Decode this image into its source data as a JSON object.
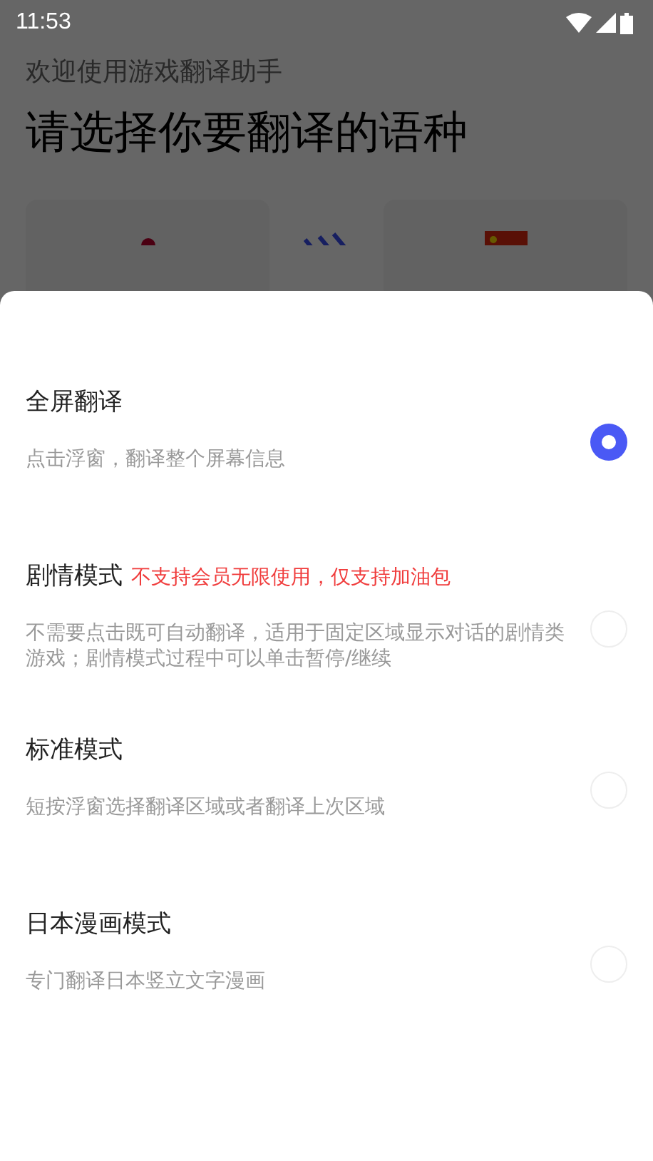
{
  "status_bar": {
    "time": "11:53"
  },
  "header": {
    "subtitle": "欢迎使用游戏翻译助手",
    "title": "请选择你要翻译的语种"
  },
  "modes": [
    {
      "title": "全屏翻译",
      "description": "点击浮窗，翻译整个屏幕信息",
      "selected": true
    },
    {
      "title": "剧情模式",
      "note": "不支持会员无限使用，仅支持加油包",
      "description": "不需要点击既可自动翻译，适用于固定区域显示对话的剧情类游戏；剧情模式过程中可以单击暂停/继续",
      "selected": false
    },
    {
      "title": "标准模式",
      "description": "短按浮窗选择翻译区域或者翻译上次区域",
      "selected": false
    },
    {
      "title": "日本漫画模式",
      "description": "专门翻译日本竖立文字漫画",
      "selected": false
    }
  ]
}
